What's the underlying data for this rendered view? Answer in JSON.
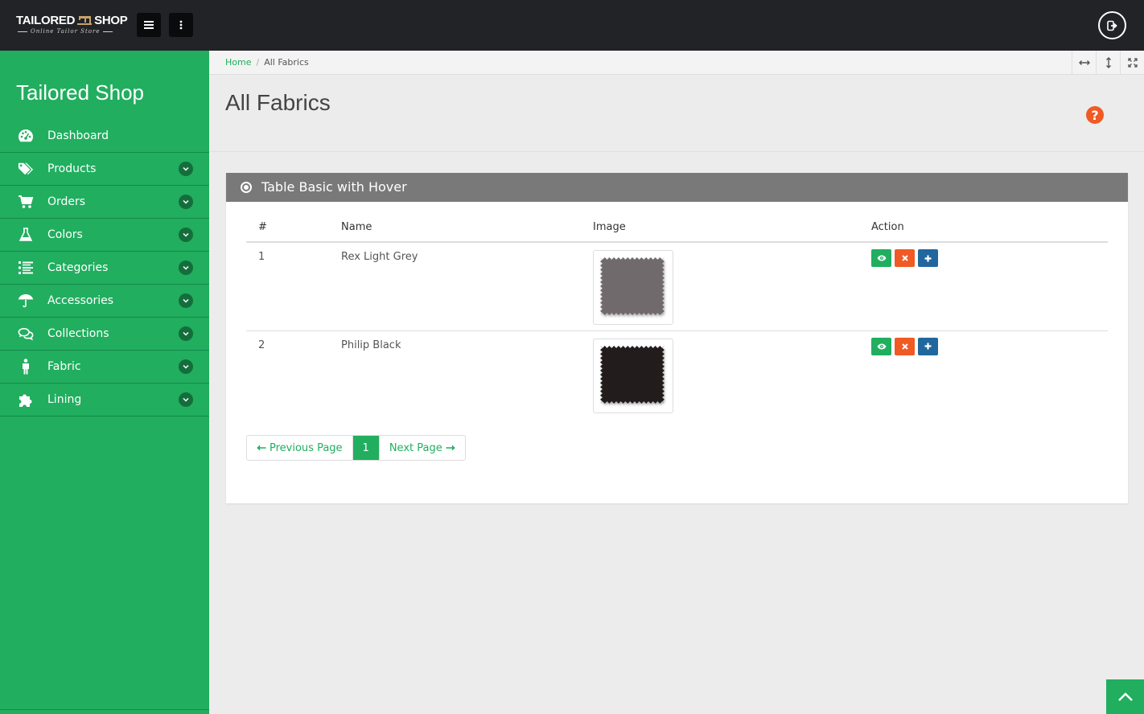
{
  "header": {
    "logo_text_left": "TAILORED",
    "logo_text_right": "SHOP",
    "logo_tagline": "Online Tailor Store",
    "menu_toggle_icon": "hamburger-icon",
    "more_icon": "vertical-dots-icon",
    "logout_icon": "logout-icon"
  },
  "sidebar": {
    "brand": "Tailored Shop",
    "items": [
      {
        "label": "Dashboard",
        "icon": "dashboard-icon",
        "has_submenu": false
      },
      {
        "label": "Products",
        "icon": "tags-icon",
        "has_submenu": true
      },
      {
        "label": "Orders",
        "icon": "cart-icon",
        "has_submenu": true
      },
      {
        "label": "Colors",
        "icon": "flask-icon",
        "has_submenu": true
      },
      {
        "label": "Categories",
        "icon": "list-icon",
        "has_submenu": true
      },
      {
        "label": "Accessories",
        "icon": "umbrella-icon",
        "has_submenu": true
      },
      {
        "label": "Collections",
        "icon": "comments-icon",
        "has_submenu": true
      },
      {
        "label": "Fabric",
        "icon": "person-icon",
        "has_submenu": true
      },
      {
        "label": "Lining",
        "icon": "puzzle-icon",
        "has_submenu": true
      }
    ]
  },
  "breadcrumb": {
    "home": "Home",
    "separator": "/",
    "current": "All Fabrics"
  },
  "page": {
    "title": "All Fabrics",
    "help_icon": "question-circle-icon"
  },
  "panel": {
    "title": "Table Basic with Hover",
    "columns": [
      "#",
      "Name",
      "Image",
      "Action"
    ],
    "rows": [
      {
        "index": "1",
        "name": "Rex Light Grey",
        "swatch_color": "#6f6a6d"
      },
      {
        "index": "2",
        "name": "Philip Black",
        "swatch_color": "#231d1f"
      }
    ]
  },
  "pagination": {
    "prev": "Previous Page",
    "current": "1",
    "next": "Next Page"
  },
  "colors": {
    "topbar": "#212326",
    "sidebar": "#21ae5f",
    "accent_green": "#21ae5f",
    "danger_orange": "#f05a24",
    "info_blue": "#21679e",
    "panel_header": "#797979"
  }
}
